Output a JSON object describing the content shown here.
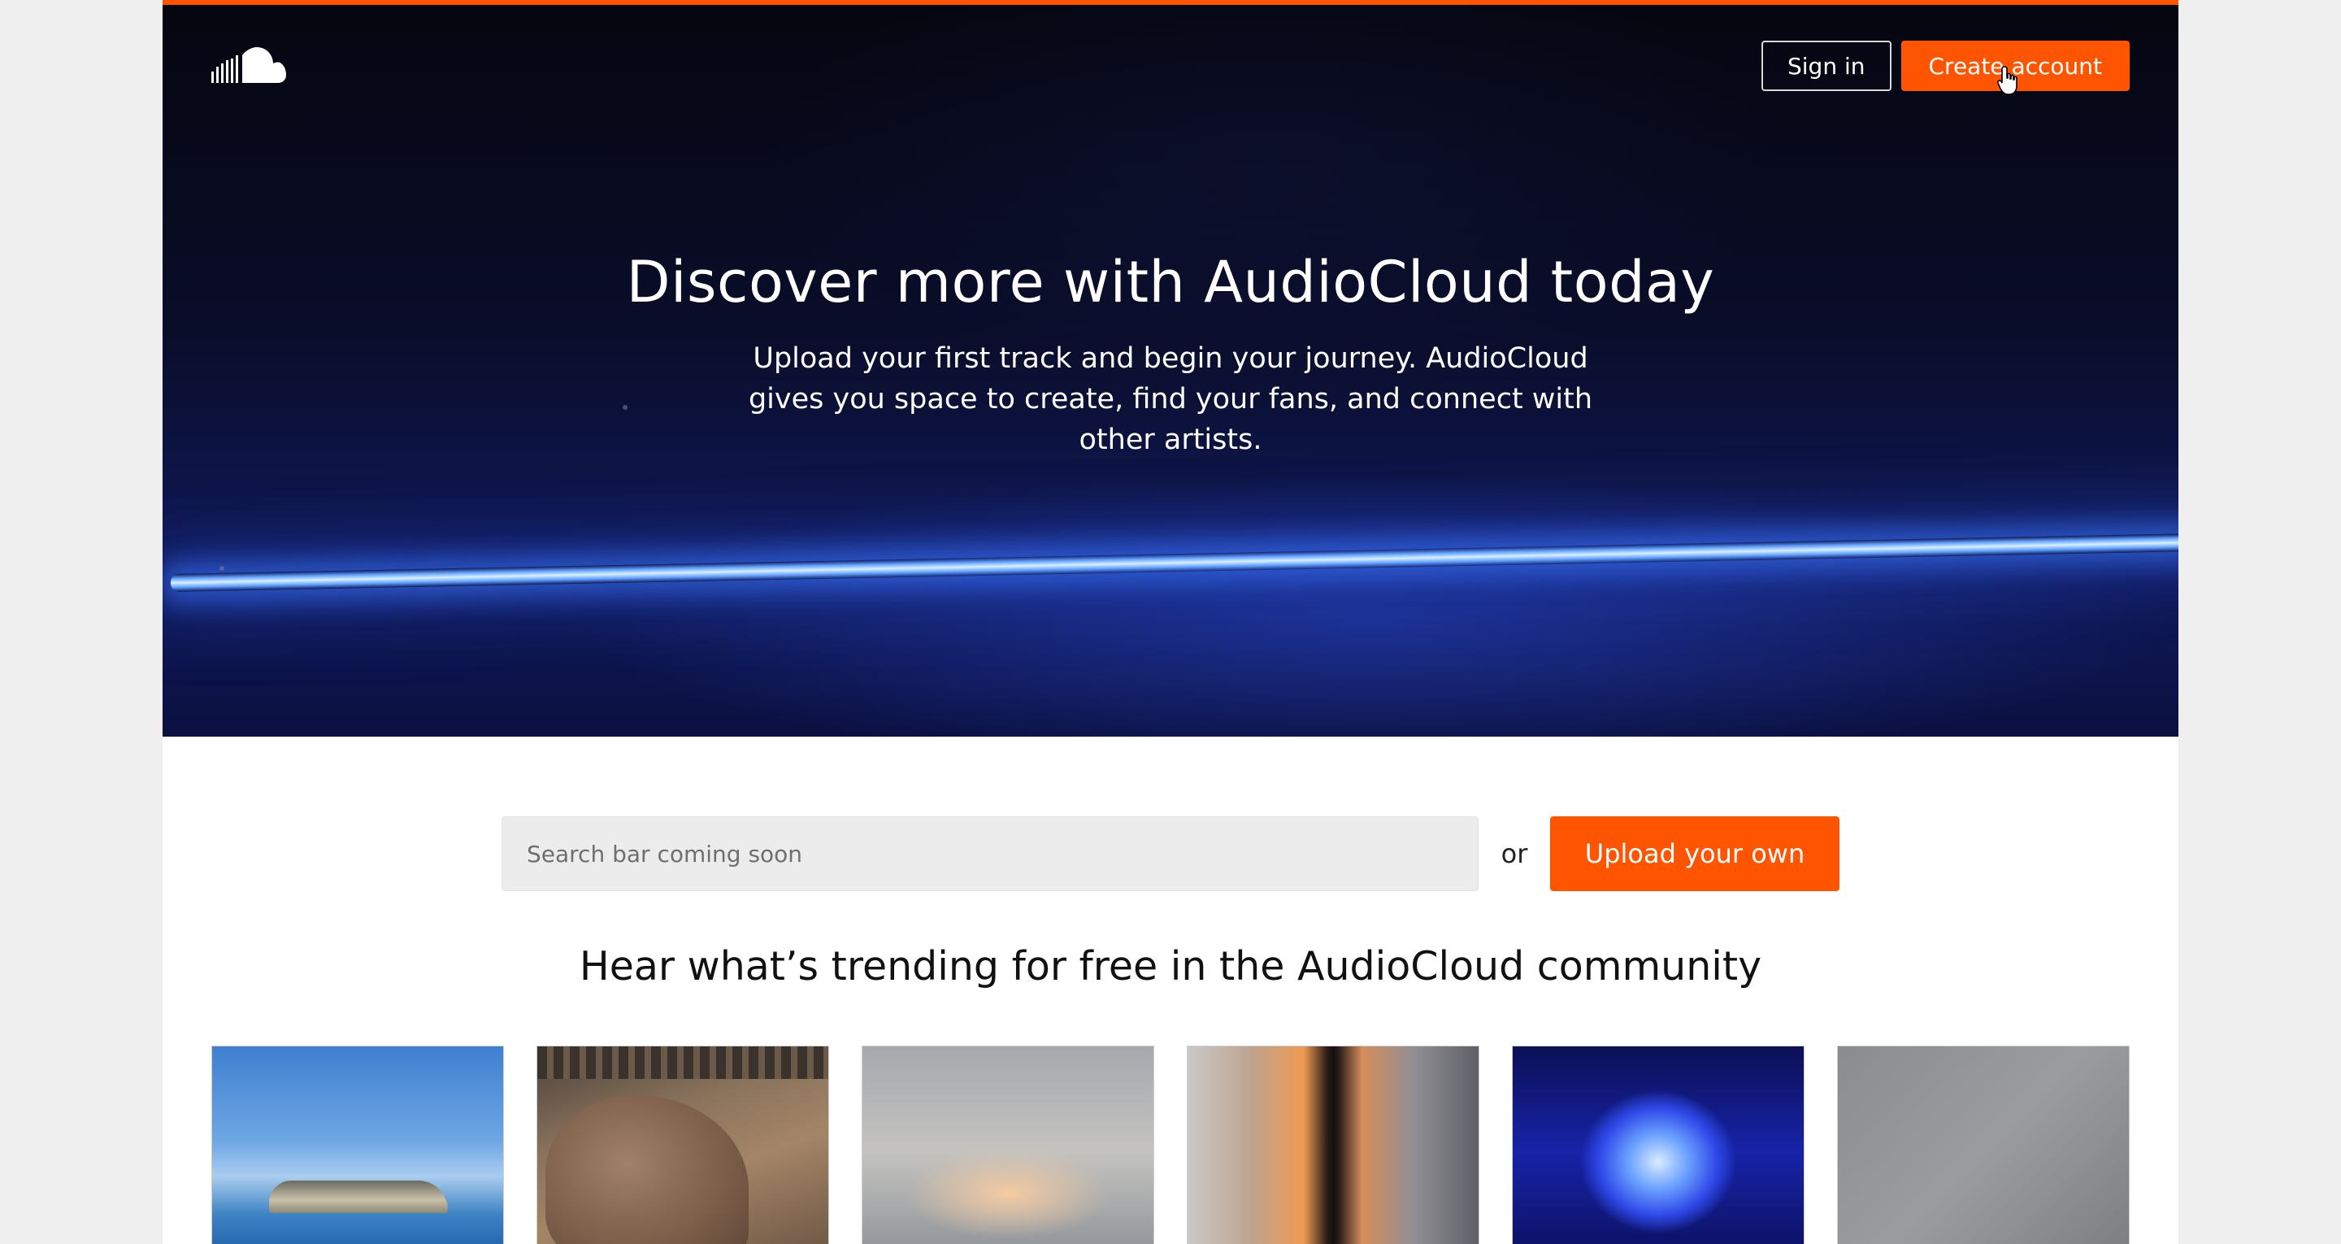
{
  "brand": {
    "logo_icon": "audiocloud-cloud-logo-icon",
    "accent_color": "#ff5500"
  },
  "header": {
    "sign_in_label": "Sign in",
    "create_account_label": "Create account"
  },
  "hero": {
    "title": "Discover more with AudioCloud today",
    "subtitle": "Upload your first track and begin your journey. AudioCloud gives you space to create, find your fans, and connect with other artists."
  },
  "search": {
    "placeholder": "Search bar coming soon",
    "value": "",
    "or_label": "or",
    "upload_label": "Upload your own"
  },
  "trending": {
    "title": "Hear what’s trending for free in the AudioCloud community",
    "tiles": [
      {
        "artwork": "island-sea-artwork"
      },
      {
        "artwork": "elephant-artwork"
      },
      {
        "artwork": "cloudy-sky-artwork"
      },
      {
        "artwork": "sunset-silhouette-artwork"
      },
      {
        "artwork": "blue-light-artwork"
      },
      {
        "artwork": "gray-placeholder-artwork"
      }
    ]
  }
}
